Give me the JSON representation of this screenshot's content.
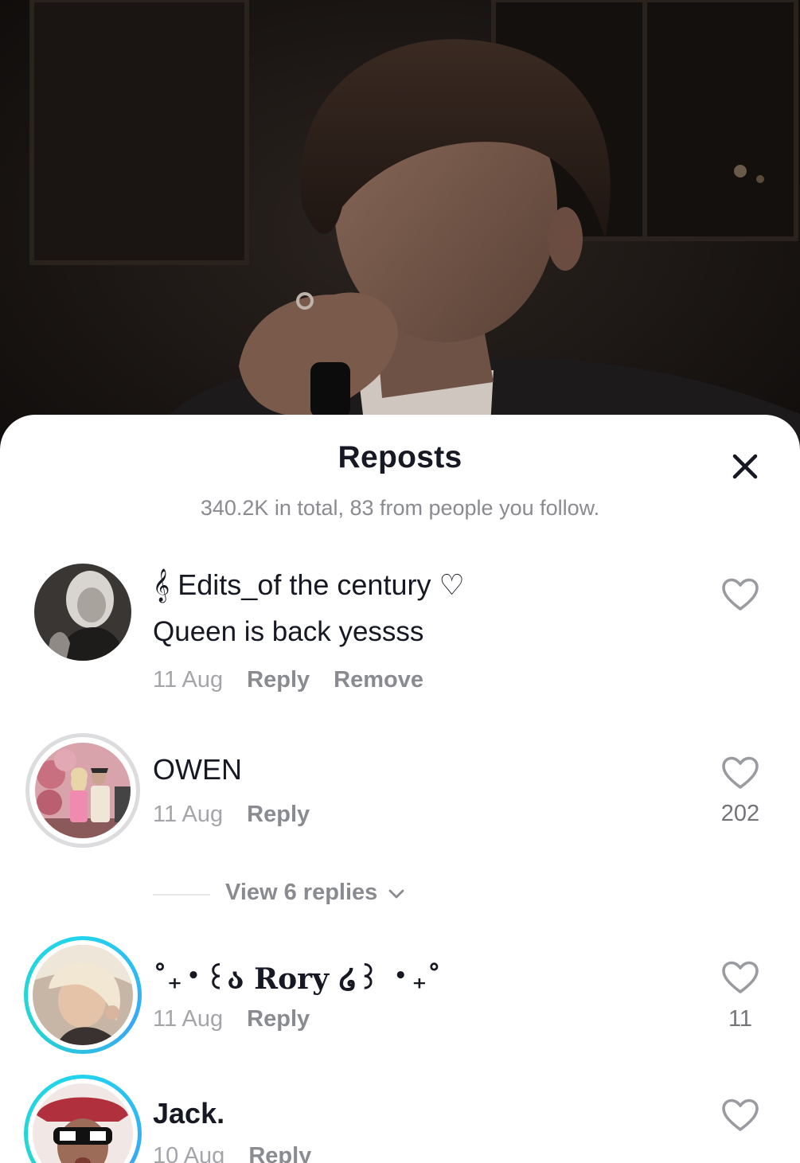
{
  "sheet": {
    "title": "Reposts",
    "subtitle": "340.2K in total, 83 from people you follow."
  },
  "comments": [
    {
      "username": "𝄞 Edits_of the century ♡",
      "text": "Queen is back yessss",
      "date": "11 Aug",
      "reply_label": "Reply",
      "remove_label": "Remove",
      "likes": ""
    },
    {
      "username": "OWEN",
      "date": "11 Aug",
      "reply_label": "Reply",
      "likes": "202"
    },
    {
      "username": "˚₊‧꒰ა Rory ໒꒱ ‧₊˚",
      "date": "11 Aug",
      "reply_label": "Reply",
      "likes": "11"
    },
    {
      "username": "Jack.",
      "date": "10 Aug",
      "reply_label": "Reply",
      "likes": ""
    }
  ],
  "view_replies_label": "View 6 replies",
  "icons": {
    "close": "close-icon",
    "like": "heart-outline-icon",
    "chevron": "chevron-down-icon"
  },
  "colors": {
    "sheet_bg": "#ffffff",
    "text_primary": "#161823",
    "text_secondary": "#8a8b91",
    "story_ring": "#22d3ee"
  }
}
